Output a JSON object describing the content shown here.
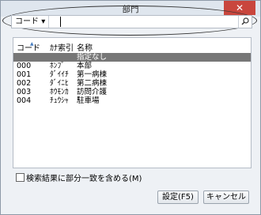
{
  "window": {
    "title": "部門",
    "close_glyph": "✕"
  },
  "search": {
    "field_label": "コード",
    "dropdown_glyph": "▾",
    "value": "",
    "search_icon": "search-icon"
  },
  "list": {
    "headers": {
      "code": "コード",
      "kana": "ｶﾅ索引",
      "name": "名称"
    },
    "rows": [
      {
        "code": "",
        "kana": "",
        "name": "指定なし",
        "selected": true
      },
      {
        "code": "000",
        "kana": "ﾎﾝﾌﾞ",
        "name": "本部"
      },
      {
        "code": "001",
        "kana": "ﾀﾞｲｲﾁ",
        "name": "第一病棟"
      },
      {
        "code": "002",
        "kana": "ﾀﾞｲﾆﾋ",
        "name": "第二病棟"
      },
      {
        "code": "003",
        "kana": "ﾎｳﾓﾝｶ",
        "name": "訪問介護"
      },
      {
        "code": "004",
        "kana": "ﾁｭｳｼｬ",
        "name": "駐車場"
      }
    ]
  },
  "options": {
    "partial_match_label": "検索結果に部分一致を含める(M)",
    "partial_match_checked": false
  },
  "buttons": {
    "ok": "設定(F5)",
    "cancel": "キャンセル"
  },
  "colors": {
    "close": "#c9463d",
    "selection": "#777777"
  }
}
